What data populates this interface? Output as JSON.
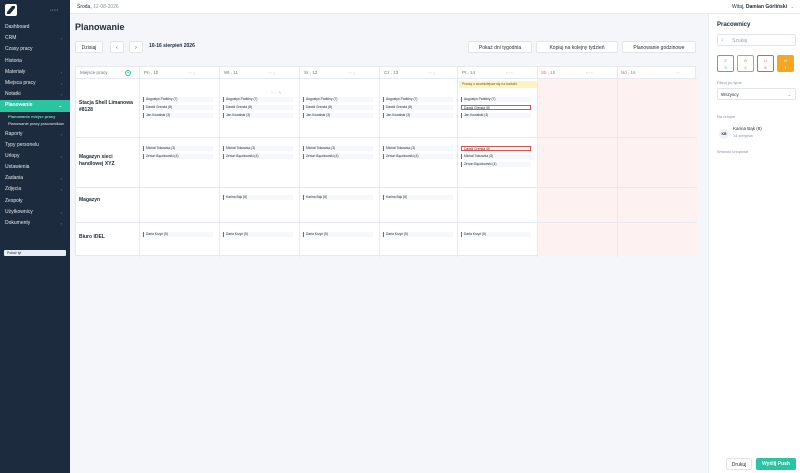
{
  "sidebar": {
    "logo_sub": "v1.6.4",
    "items": [
      {
        "label": "Dashboard",
        "chevron": false
      },
      {
        "label": "CRM",
        "chevron": true
      },
      {
        "label": "Czasy pracy",
        "chevron": false
      },
      {
        "label": "Historia",
        "chevron": false
      },
      {
        "label": "Materiały",
        "chevron": true
      },
      {
        "label": "Miejsca pracy",
        "chevron": true
      },
      {
        "label": "Notatki",
        "chevron": true
      },
      {
        "label": "Planowanie",
        "chevron": true,
        "active": true
      }
    ],
    "subitems": [
      "Planowanie miejsc pracy",
      "Planowanie pracy pracowników"
    ],
    "items2": [
      {
        "label": "Raporty",
        "chevron": true
      },
      {
        "label": "Typy personelu",
        "chevron": false
      },
      {
        "label": "Urlopy",
        "chevron": true
      },
      {
        "label": "Ustawienia",
        "chevron": false
      },
      {
        "label": "Zadania",
        "chevron": true
      },
      {
        "label": "Zdjęcia",
        "chevron": true
      },
      {
        "label": "Zespoły",
        "chevron": false
      },
      {
        "label": "Użytkownicy",
        "chevron": true
      },
      {
        "label": "Dokumenty",
        "chevron": true
      }
    ],
    "button": "Pokaż tył"
  },
  "topbar": {
    "day": "Środa,",
    "date": "12-08-2026",
    "greeting": "Witaj,",
    "user": "Damian Górliński"
  },
  "page": {
    "title": "Planowanie",
    "today_btn": "Dzisiaj",
    "prev": "‹",
    "next": "›",
    "week_range": "10-16 sierpień 2026",
    "show_days_btn": "Pokaż dni tygodnia",
    "copy_btn": "Kopiuj na kolejny tydzień",
    "hourly_btn": "Planowanie godzinowe"
  },
  "schedule": {
    "location_header": "Miejsce pracy",
    "days": [
      {
        "label": "Pn , 10",
        "weekend": false
      },
      {
        "label": "Wt , 11",
        "weekend": false
      },
      {
        "label": "Śr , 12",
        "weekend": false
      },
      {
        "label": "Cz , 13",
        "weekend": false
      },
      {
        "label": "Pt , 14",
        "weekend": false
      },
      {
        "label": "Sb , 15",
        "weekend": true
      },
      {
        "label": "Nd , 16",
        "weekend": true
      }
    ],
    "notice": "Proszę o wcześniejsze się na kontakt",
    "locations": [
      {
        "name": "Stacja Shell Limanowa #8128"
      },
      {
        "name": "Magazyn sieci handlowej XYZ"
      },
      {
        "name": "Magazyn"
      },
      {
        "name": "Biuro IDEL"
      }
    ],
    "chips": {
      "augustyn": "Augustyn Parkitny (7)",
      "dawid": "Dawid Grenda (8)",
      "jan": "Jan Kowalski (3)",
      "michal": "Michał Tokuszka (3)",
      "zenon": "Zenon Bączkowski (4)",
      "karina": "Karina Bąk (8)",
      "daria": "Daria Krzyż (5)"
    }
  },
  "right_panel": {
    "title": "Pracownicy",
    "search_placeholder": "Szukaj",
    "statuses": [
      {
        "letter": "Z",
        "count": "3",
        "color": "#2bc4a1"
      },
      {
        "letter": "W",
        "count": "6",
        "color": "#8bc34a"
      },
      {
        "letter": "U",
        "count": "6",
        "color": "#e05a5a"
      },
      {
        "letter": "N",
        "count": "1",
        "color": "#f5a623"
      }
    ],
    "filter_label": "Filtruj po typie",
    "filter_value": "Wszyscy",
    "leave_label": "Na urlopie",
    "leave_person": {
      "initials": "KB",
      "name": "Karina Bąk (8)",
      "date": "14 sierpnia"
    },
    "requests_label": "Wnioski urlopowe",
    "draft_btn": "Drukuj",
    "push_btn": "Wyślij Push"
  }
}
